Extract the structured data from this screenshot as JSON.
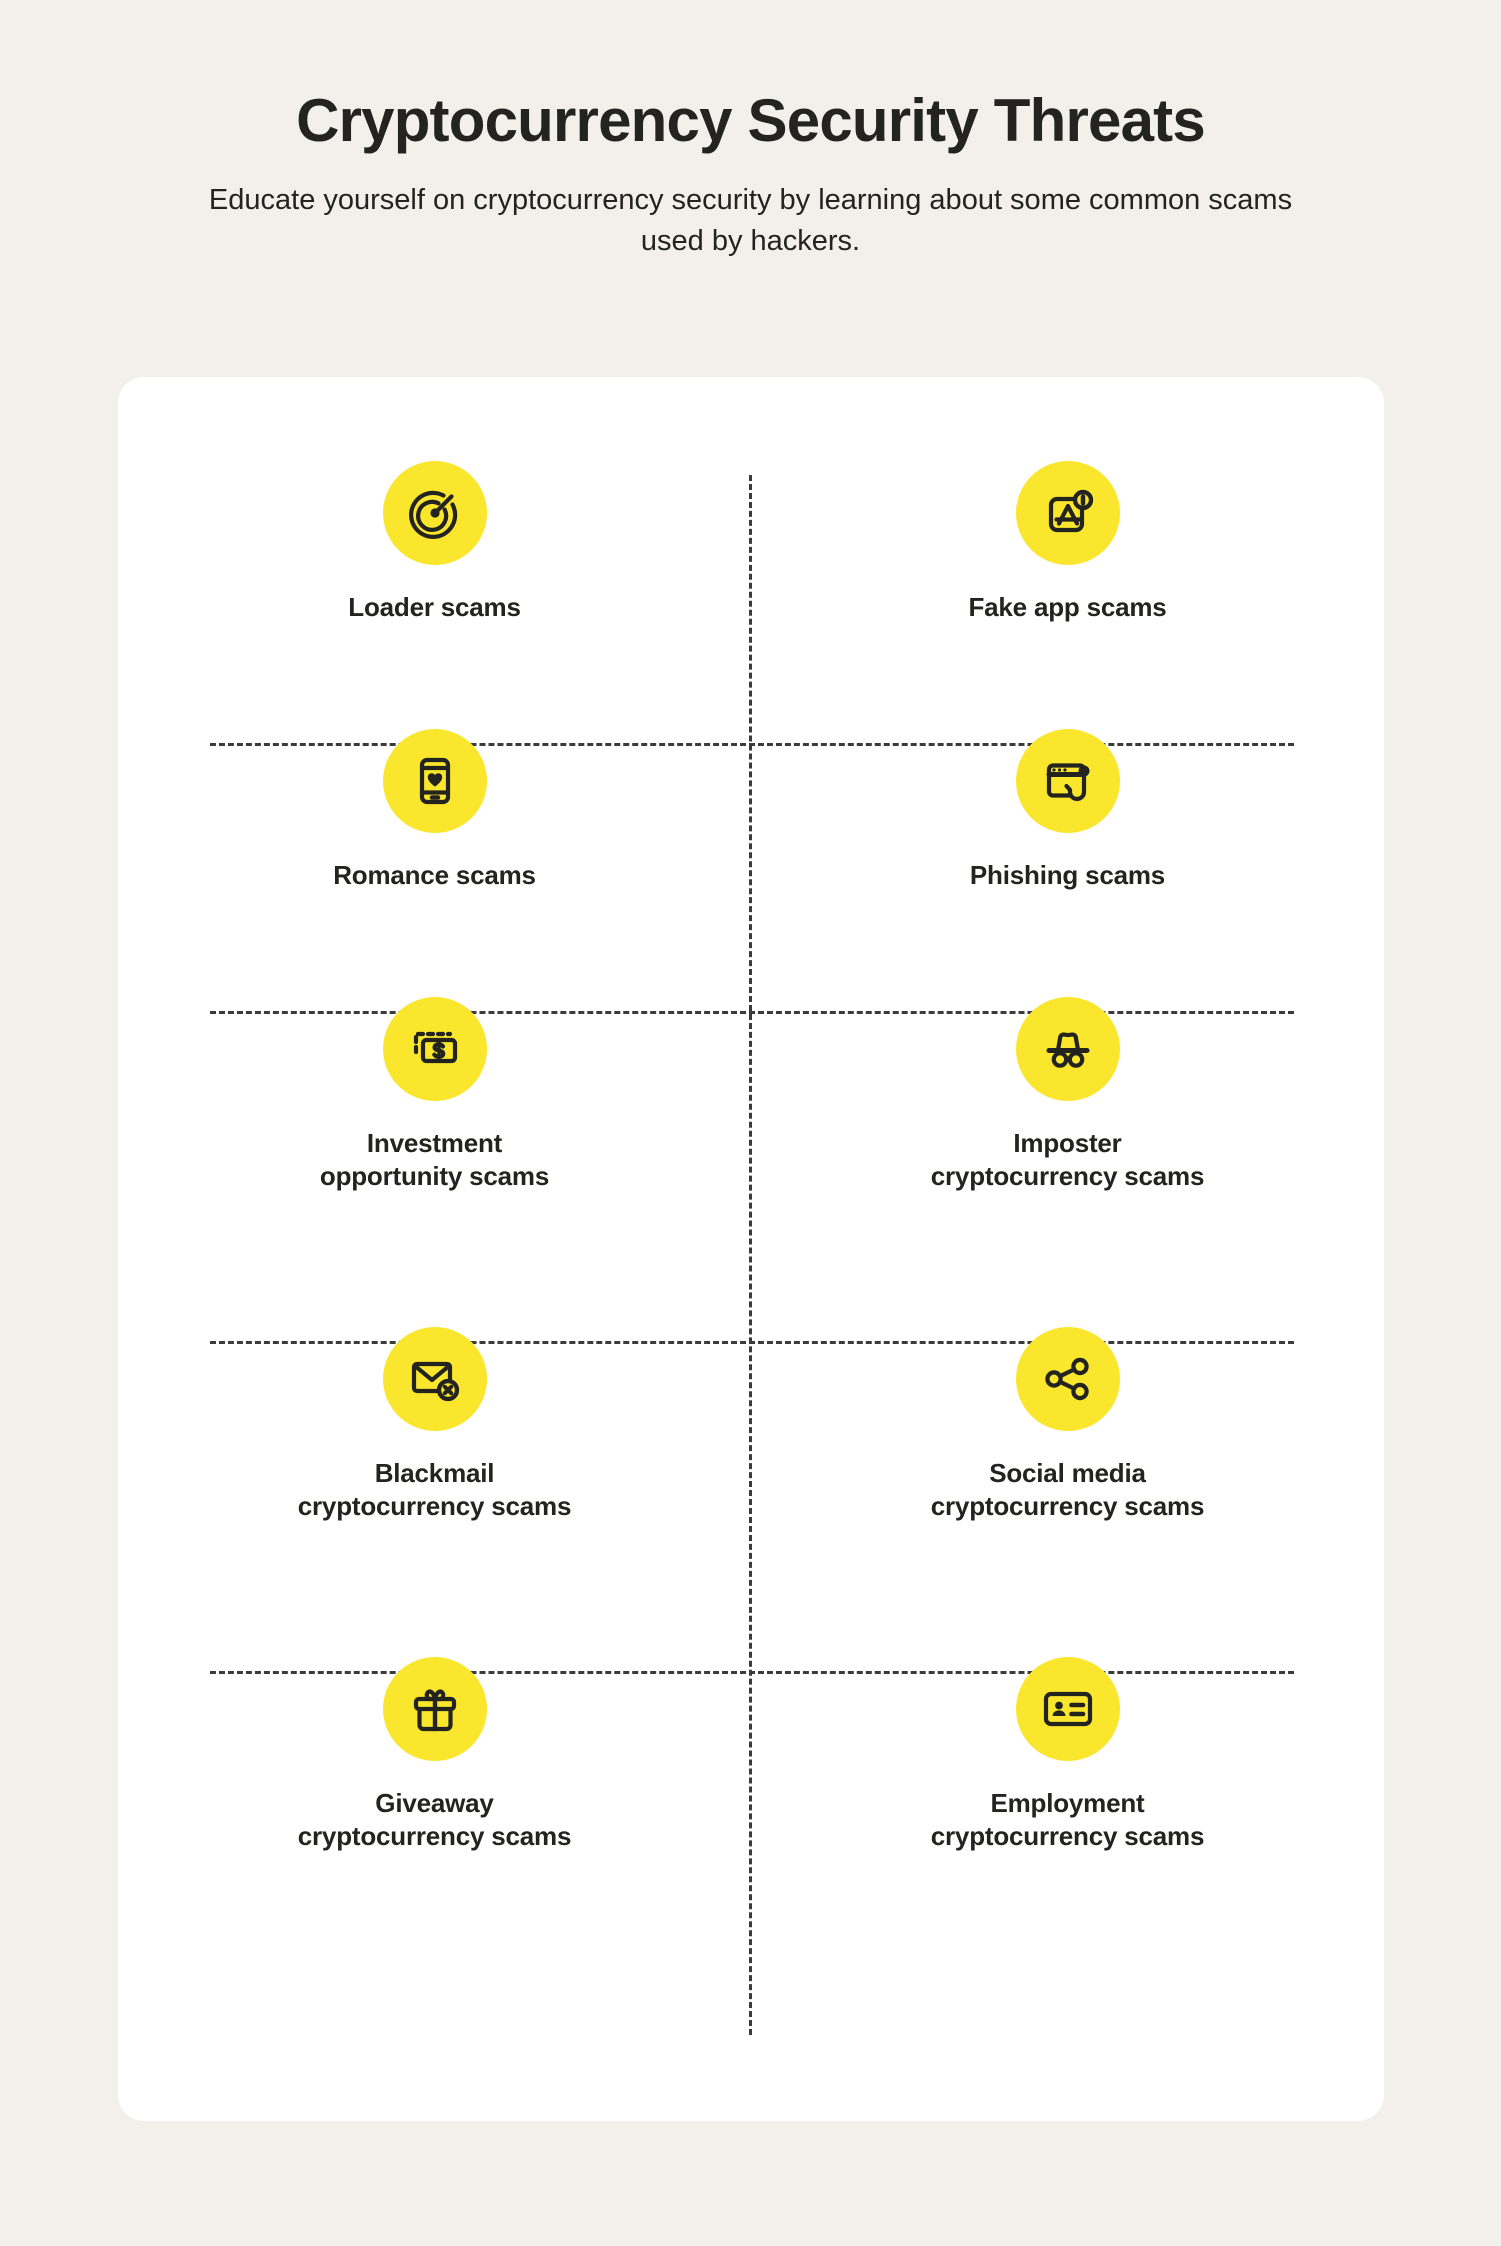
{
  "header": {
    "title": "Cryptocurrency Security Threats",
    "subtitle": "Educate yourself on cryptocurrency security by learning about some common scams used by hackers."
  },
  "colors": {
    "page_background": "#f3f0eb",
    "card_background": "#ffffff",
    "icon_circle": "#fae62d",
    "text": "#23231f",
    "divider": "#3b3b39"
  },
  "items": [
    {
      "label": "Loader scams",
      "icon": "target-radar-icon"
    },
    {
      "label": "Fake app scams",
      "icon": "app-store-badge-icon"
    },
    {
      "label": "Romance scams",
      "icon": "phone-heart-icon"
    },
    {
      "label": "Phishing scams",
      "icon": "browser-fishhook-icon"
    },
    {
      "label": "Investment\nopportunity scams",
      "icon": "dollar-bill-icon"
    },
    {
      "label": "Imposter\ncryptocurrency scams",
      "icon": "incognito-hat-glasses-icon"
    },
    {
      "label": "Blackmail\ncryptocurrency scams",
      "icon": "envelope-x-icon"
    },
    {
      "label": "Social media\ncryptocurrency scams",
      "icon": "share-network-icon"
    },
    {
      "label": "Giveaway\ncryptocurrency scams",
      "icon": "gift-box-icon"
    },
    {
      "label": "Employment\ncryptocurrency scams",
      "icon": "id-card-icon"
    }
  ]
}
